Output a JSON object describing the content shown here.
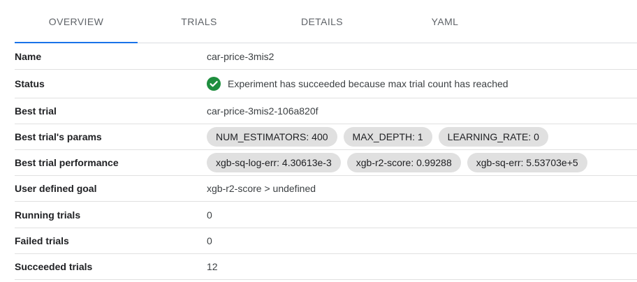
{
  "tabs": [
    {
      "label": "OVERVIEW",
      "active": true
    },
    {
      "label": "TRIALS",
      "active": false
    },
    {
      "label": "DETAILS",
      "active": false
    },
    {
      "label": "YAML",
      "active": false
    }
  ],
  "details": {
    "name": {
      "label": "Name",
      "value": "car-price-3mis2"
    },
    "status": {
      "label": "Status",
      "value": "Experiment has succeeded because max trial count has reached",
      "icon": "check-circle-icon",
      "color": "#1e8e3e"
    },
    "best_trial": {
      "label": "Best trial",
      "value": "car-price-3mis2-106a820f"
    },
    "best_params": {
      "label": "Best trial's params",
      "chips": [
        "NUM_ESTIMATORS: 400",
        "MAX_DEPTH: 1",
        "LEARNING_RATE: 0"
      ]
    },
    "best_performance": {
      "label": "Best trial performance",
      "chips": [
        "xgb-sq-log-err: 4.30613e-3",
        "xgb-r2-score: 0.99288",
        "xgb-sq-err: 5.53703e+5"
      ]
    },
    "goal": {
      "label": "User defined goal",
      "value": "xgb-r2-score > undefined"
    },
    "running": {
      "label": "Running trials",
      "value": "0"
    },
    "failed": {
      "label": "Failed trials",
      "value": "0"
    },
    "succeeded": {
      "label": "Succeeded trials",
      "value": "12"
    }
  },
  "colors": {
    "accent": "#1a73e8",
    "chip_bg": "#e0e0e0"
  }
}
